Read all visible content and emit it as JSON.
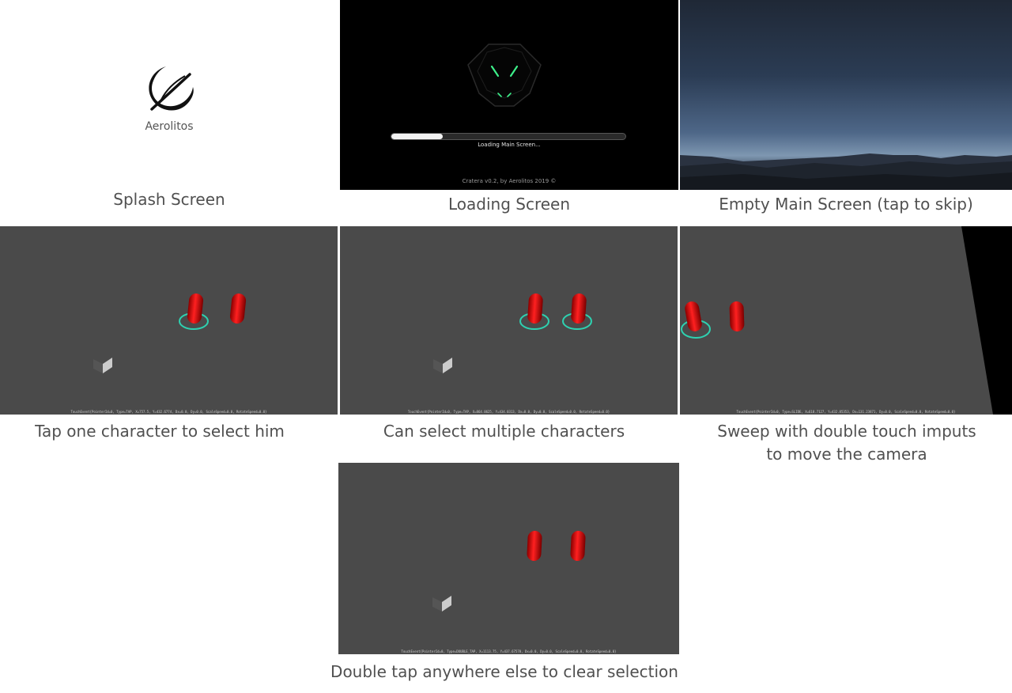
{
  "colors": {
    "ground": "#4a4a4a",
    "character": "#cc0000",
    "selection_ring": "#2ed1b0",
    "caption": "#505050"
  },
  "panels": {
    "splash": {
      "caption": "Splash Screen",
      "logo_text": "Aerolitos",
      "icon": "aerolitos-logo"
    },
    "loading": {
      "caption": "Loading Screen",
      "status": "Loading Main Screen...",
      "version": "Cratera v0.2, by Aerolitos 2019 ©",
      "progress": 0.22,
      "icon": "helmet-emblem"
    },
    "main": {
      "caption": "Empty Main Screen (tap to skip)"
    },
    "tap_select": {
      "caption": "Tap one character to select him",
      "debug": "TouchEvent{PointerId=0, Type=TAP, X=757.5, Y=432.6774, Dx=0.0, Dy=0.0, ScaleSpeed=0.0, RotateSpeed=0.0}"
    },
    "multi_select": {
      "caption": "Can select multiple characters",
      "debug": "TouchEvent{PointerId=0, Type=TAP, X=864.0625, Y=434.0313, Dx=0.0, Dy=0.0, ScaleSpeed=0.0, RotateSpeed=0.0}"
    },
    "sweep": {
      "caption_line1": "Sweep with double touch imputs",
      "caption_line2": "to move the camera",
      "debug": "TouchEvent{PointerId=0, Type=SLIDE, X=618.7127, Y=432.85353, Dx=131.23871, Dy=0.0, ScaleSpeed=0.0, RotateSpeed=0.0}"
    },
    "clear": {
      "caption": "Double tap anywhere else to clear selection",
      "debug": "TouchEvent{PointerId=0, Type=DOUBLE_TAP, X=1113.75, Y=437.67578, Dx=0.0, Dy=0.0, ScaleSpeed=0.0, RotateSpeed=0.0}"
    }
  }
}
